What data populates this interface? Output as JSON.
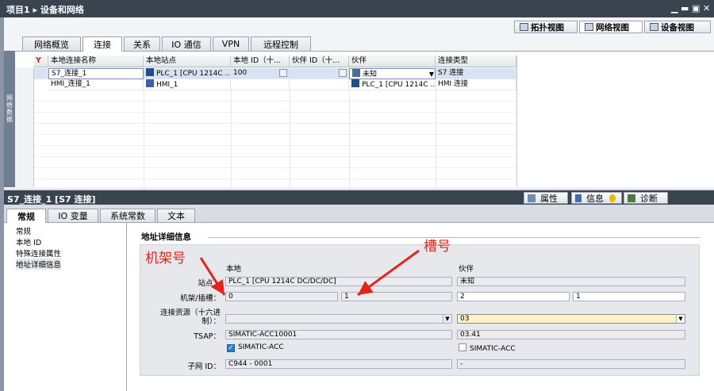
{
  "title_bar": {
    "breadcrumb": "项目1 ▸ 设备和网络",
    "window_buttons": [
      "▁",
      "▬",
      "▣",
      "✕"
    ]
  },
  "view_buttons": [
    "拓扑视图",
    "网络视图",
    "设备视图"
  ],
  "side_panel_label": "网络数据",
  "upper_tabs": [
    "网络概览",
    "连接",
    "关系",
    "IO 通信",
    "VPN",
    "远程控制"
  ],
  "connections_table": {
    "headers": [
      "本地连接名称",
      "本地站点",
      "本地 ID（十...",
      "伙伴 ID（十...",
      "伙伴",
      "连接类型"
    ],
    "rows": [
      [
        "S7_连接_1",
        "PLC_1 [CPU 1214C ...",
        "100",
        "",
        "未知",
        "S7 连接"
      ],
      [
        "HMI_连接_1",
        "HMI_1",
        "",
        "",
        "PLC_1 [CPU 1214C ...",
        "HMI 连接"
      ]
    ]
  },
  "inspector": {
    "title": "S7_连接_1 [S7 连接]",
    "buttons": [
      "属性",
      "信息",
      "诊断"
    ],
    "tabs": [
      "常规",
      "IO 变量",
      "系统常数",
      "文本"
    ],
    "nav": [
      "常规",
      "本地 ID",
      "特殊连接属性",
      "地址详细信息"
    ]
  },
  "address_details": {
    "section_title": "地址详细信息",
    "col_local": "本地",
    "col_partner": "伙伴",
    "labels": {
      "station": "站点：",
      "rack_slot": "机架/插槽：",
      "conn_resource_1": "连接资源（十六进",
      "conn_resource_2": "制）：",
      "tsap": "TSAP：",
      "subnet_id": "子网 ID："
    },
    "local": {
      "station": "PLC_1 [CPU 1214C DC/DC/DC]",
      "rack": "0",
      "slot": "1",
      "conn_resource": "",
      "tsap": "SIMATIC-ACC10001",
      "simatic_acc": "SIMATIC-ACC",
      "subnet_id": "C944 - 0001"
    },
    "partner": {
      "station": "未知",
      "rack": "2",
      "slot": "1",
      "conn_resource": "03",
      "tsap": "03.41",
      "simatic_acc": "SIMATIC-ACC",
      "subnet_id": "-"
    }
  },
  "annotations": {
    "rack": "机架号",
    "slot": "槽号"
  },
  "colors": {
    "annotation": "#e5231b",
    "title_bar": "#3a4350"
  }
}
